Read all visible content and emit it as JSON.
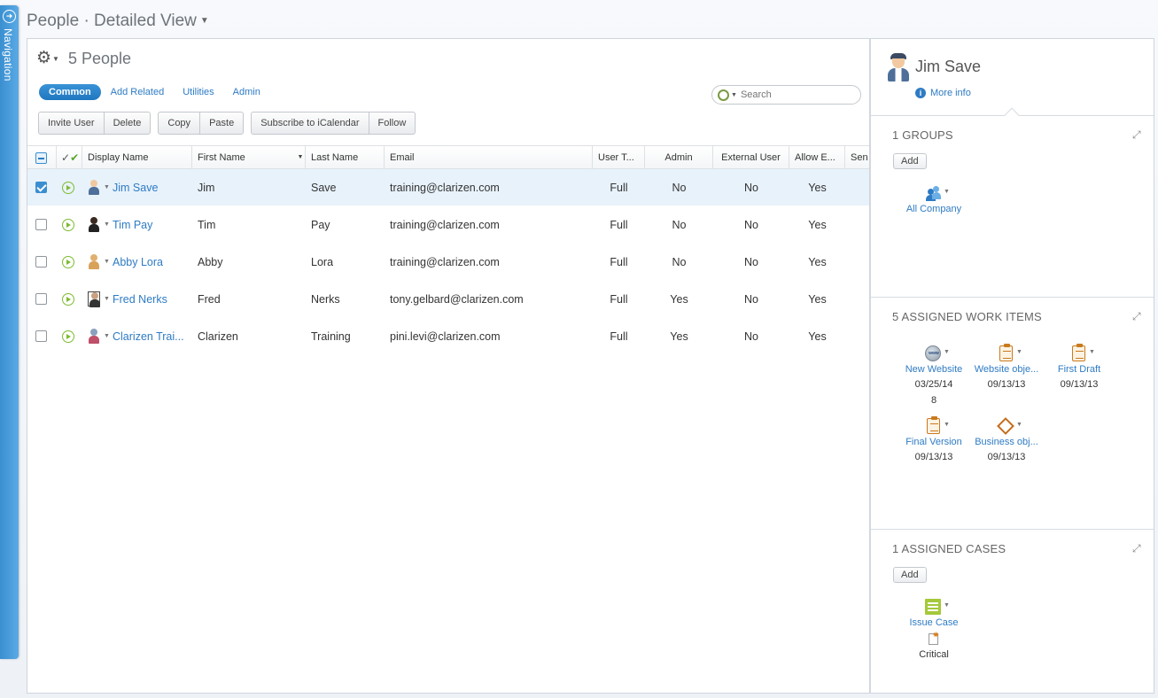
{
  "navigation": {
    "label": "Navigation"
  },
  "page": {
    "title": "People · Detailed View"
  },
  "main": {
    "count_title": "5 People",
    "tabs": [
      {
        "label": "Common",
        "active": true
      },
      {
        "label": "Add Related",
        "active": false
      },
      {
        "label": "Utilities",
        "active": false
      },
      {
        "label": "Admin",
        "active": false
      }
    ],
    "search": {
      "placeholder": "Search",
      "value": ""
    },
    "toolbar": {
      "invite_user": "Invite User",
      "delete": "Delete",
      "copy": "Copy",
      "paste": "Paste",
      "subscribe": "Subscribe to iCalendar",
      "follow": "Follow"
    }
  },
  "grid": {
    "columns": {
      "display_name": "Display Name",
      "first_name": "First Name",
      "last_name": "Last Name",
      "email": "Email",
      "user_type": "User T...",
      "admin": "Admin",
      "external_user": "External User",
      "allow_e": "Allow E...",
      "sen": "Sen"
    },
    "rows": [
      {
        "display_name": "Jim Save",
        "first_name": "Jim",
        "last_name": "Save",
        "email": "training@clarizen.com",
        "user_type": "Full",
        "admin": "No",
        "external_user": "No",
        "allow_e": "Yes",
        "selected": true
      },
      {
        "display_name": "Tim Pay",
        "first_name": "Tim",
        "last_name": "Pay",
        "email": "training@clarizen.com",
        "user_type": "Full",
        "admin": "No",
        "external_user": "No",
        "allow_e": "Yes",
        "selected": false
      },
      {
        "display_name": "Abby Lora",
        "first_name": "Abby",
        "last_name": "Lora",
        "email": "training@clarizen.com",
        "user_type": "Full",
        "admin": "No",
        "external_user": "No",
        "allow_e": "Yes",
        "selected": false
      },
      {
        "display_name": "Fred Nerks",
        "first_name": "Fred",
        "last_name": "Nerks",
        "email": "tony.gelbard@clarizen.com",
        "user_type": "Full",
        "admin": "Yes",
        "external_user": "No",
        "allow_e": "Yes",
        "selected": false
      },
      {
        "display_name": "Clarizen Trai...",
        "first_name": "Clarizen",
        "last_name": "Training",
        "email": "pini.levi@clarizen.com",
        "user_type": "Full",
        "admin": "Yes",
        "external_user": "No",
        "allow_e": "Yes",
        "selected": false
      }
    ]
  },
  "side": {
    "person_name": "Jim Save",
    "more_info": "More info",
    "groups": {
      "title": "1 GROUPS",
      "add": "Add",
      "items": [
        {
          "label": "All Company"
        }
      ]
    },
    "work_items": {
      "title": "5 ASSIGNED WORK ITEMS",
      "items": [
        {
          "label": "New Website",
          "date": "03/25/14",
          "extra": "8",
          "icon": "website-icon"
        },
        {
          "label": "Website obje...",
          "date": "09/13/13",
          "icon": "clipboard-icon"
        },
        {
          "label": "First Draft",
          "date": "09/13/13",
          "icon": "clipboard-icon"
        },
        {
          "label": "Final Version",
          "date": "09/13/13",
          "icon": "clipboard-icon"
        },
        {
          "label": "Business obj...",
          "date": "09/13/13",
          "icon": "milestone-diamond-icon"
        }
      ]
    },
    "cases": {
      "title": "1 ASSIGNED CASES",
      "add": "Add",
      "items": [
        {
          "label": "Issue Case",
          "severity": "Critical"
        }
      ]
    }
  }
}
